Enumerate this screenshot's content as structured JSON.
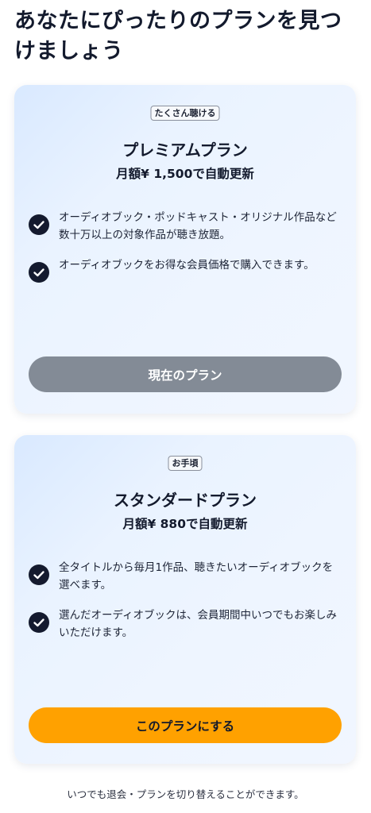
{
  "header": {
    "title": "あなたにぴったりのプランを見つけましょう"
  },
  "plans": [
    {
      "badge": "たくさん聴ける",
      "name": "プレミアムプラン",
      "price": "月額¥ 1,500で自動更新",
      "features": [
        "オーディオブック・ポッドキャスト・オリジナル作品など数十万以上の対象作品が聴き放題。",
        "オーディオブックをお得な会員価格で購入できます。"
      ],
      "button_label": "現在のプラン",
      "button_state": "current"
    },
    {
      "badge": "お手頃",
      "name": "スタンダードプラン",
      "price": "月額¥ 880で自動更新",
      "features": [
        "全タイトルから毎月1作品、聴きたいオーディオブックを選べます。",
        "選んだオーディオブックは、会員期間中いつでもお楽しみいただけます。"
      ],
      "button_label": "このプランにする",
      "button_state": "selectable"
    }
  ],
  "footer": {
    "note": "いつでも退会・プランを切り替えることができます。"
  },
  "icons": {
    "feature": "check-circle-icon"
  },
  "colors": {
    "primary_button": "#ffa100",
    "current_button": "#838b96",
    "check_icon": "#141a2e",
    "card_background": "#eef5ff"
  }
}
